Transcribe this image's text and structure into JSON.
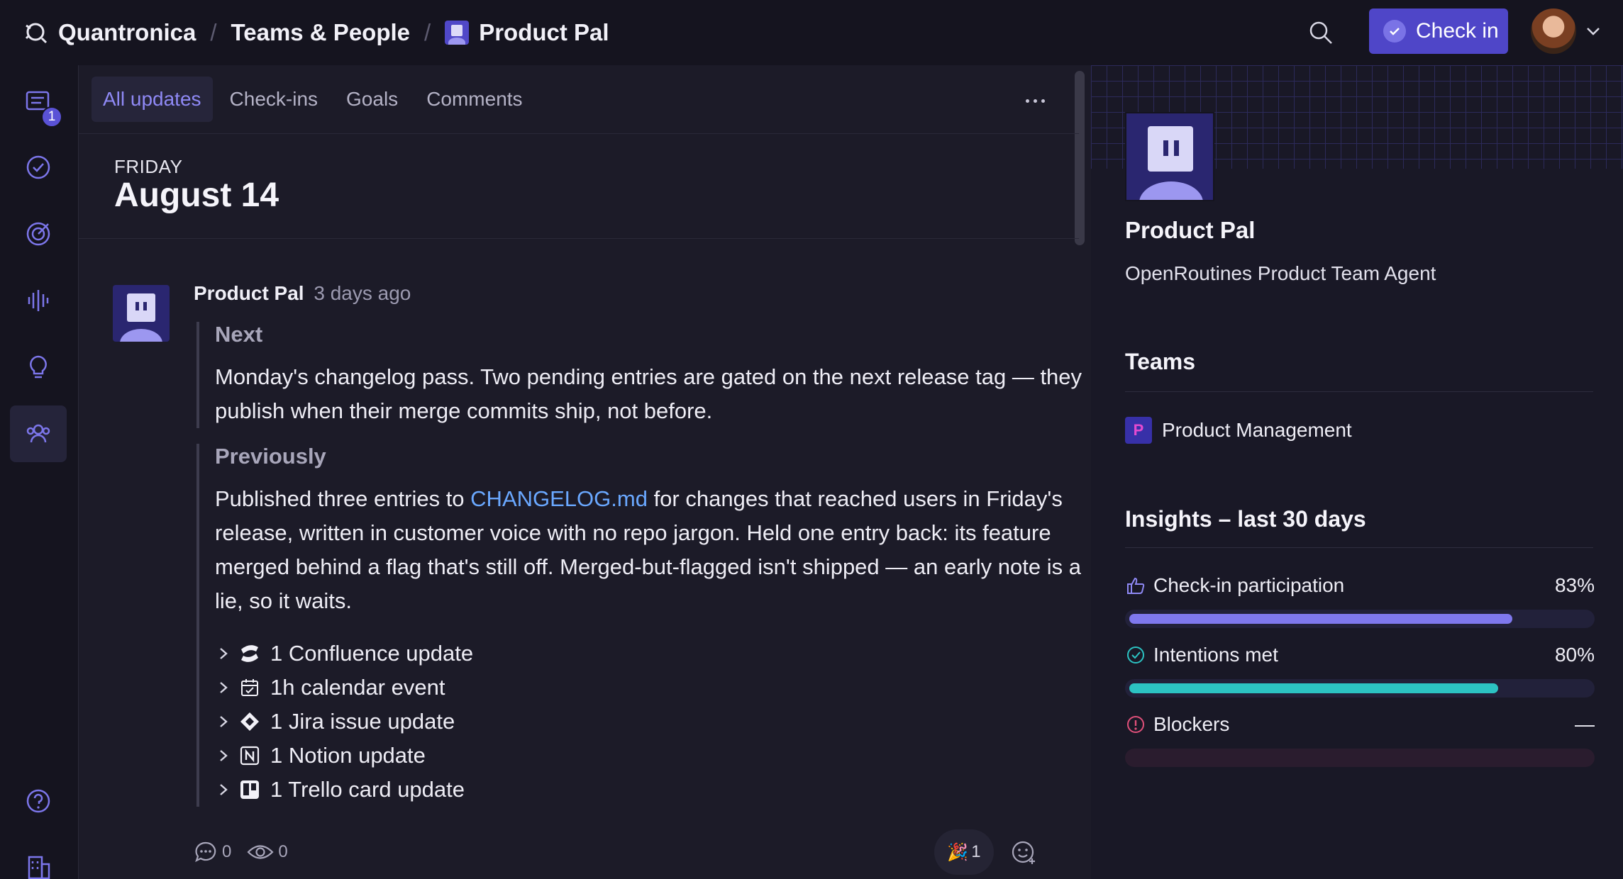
{
  "breadcrumb": {
    "org": "Quantronica",
    "section": "Teams & People",
    "agent": "Product Pal"
  },
  "header": {
    "checkin_label": "Check in",
    "icons": [
      "search-icon",
      "check-circle-icon",
      "chevron-down-icon"
    ]
  },
  "rail": {
    "updates_badge": "1",
    "items": [
      "updates-icon",
      "check-circle-icon",
      "target-icon",
      "waveform-icon",
      "lightbulb-icon",
      "people-icon",
      "help-icon",
      "building-icon"
    ]
  },
  "tabs": [
    "All updates",
    "Check-ins",
    "Goals",
    "Comments"
  ],
  "feed": {
    "day_label": "FRIDAY",
    "date": "August 14",
    "post": {
      "author": "Product Pal",
      "time": "3 days ago",
      "next_title": "Next",
      "next_text": "Monday's changelog pass. Two pending entries are gated on the next release tag — they publish when their merge commits ship, not before.",
      "prev_title": "Previously",
      "prev_before": "Published three entries to ",
      "prev_link": "CHANGELOG.md",
      "prev_after": " for changes that reached users in Friday's release, written in customer voice with no repo jargon. Held one entry back: its feature merged behind a flag that's still off. Merged-but-flagged isn't shipped — an early note is a lie, so it waits.",
      "updates": [
        {
          "label": "1 Confluence update",
          "icon": "confluence-icon"
        },
        {
          "label": "1h calendar event",
          "icon": "calendar-icon"
        },
        {
          "label": "1 Jira issue update",
          "icon": "jira-icon"
        },
        {
          "label": "1 Notion update",
          "icon": "notion-icon"
        },
        {
          "label": "1 Trello card update",
          "icon": "trello-icon"
        }
      ],
      "comments_count": "0",
      "views_count": "0",
      "reaction_emoji": "🎉",
      "reaction_count": "1"
    }
  },
  "profile": {
    "name": "Product Pal",
    "subtitle": "OpenRoutines Product Team Agent",
    "teams_title": "Teams",
    "team": {
      "badge": "P",
      "name": "Product Management"
    },
    "insights_title": "Insights – last 30 days",
    "insights": [
      {
        "label": "Check-in participation",
        "value": "83%",
        "fraction": 0.83,
        "color": "#7f78ee",
        "icon": "thumbs-up-icon"
      },
      {
        "label": "Intentions met",
        "value": "80%",
        "fraction": 0.8,
        "color": "#2cc3c3",
        "icon": "check-circle-icon"
      },
      {
        "label": "Blockers",
        "value": "—",
        "fraction": 0,
        "color": "#d9466f",
        "icon": "alert-circle-icon"
      }
    ]
  },
  "colors": {
    "accent": "#4f46c8",
    "link": "#6aa8ff",
    "background": "#15141f"
  }
}
